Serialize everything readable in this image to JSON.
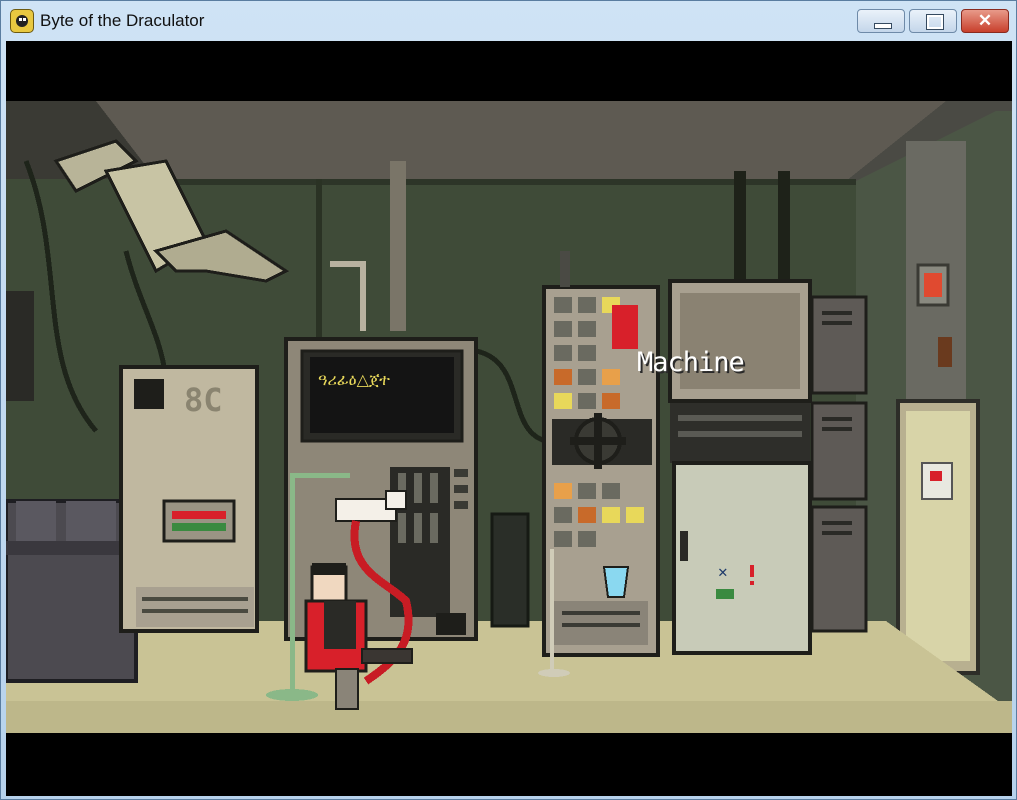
{
  "window": {
    "title": "Byte of the Draculator",
    "icon": "dracula-face-icon",
    "controls": {
      "minimize_icon": "minimize-icon",
      "maximize_icon": "maximize-icon",
      "close_icon": "close-icon",
      "close_glyph": "✕"
    }
  },
  "game": {
    "hover_label": "Machine",
    "console_screen_text": "ዓሪፊዕ△ጀተ",
    "readout_8c": "8C"
  },
  "colors": {
    "wall": "#3f4b38",
    "floor": "#c9c395",
    "ceiling": "#5e5a52",
    "machine": "#8e8778",
    "fridge": "#c8cbb8",
    "couch": "#4c4a50",
    "accent_red": "#d8202a",
    "accent_yellow": "#e8d85a"
  }
}
